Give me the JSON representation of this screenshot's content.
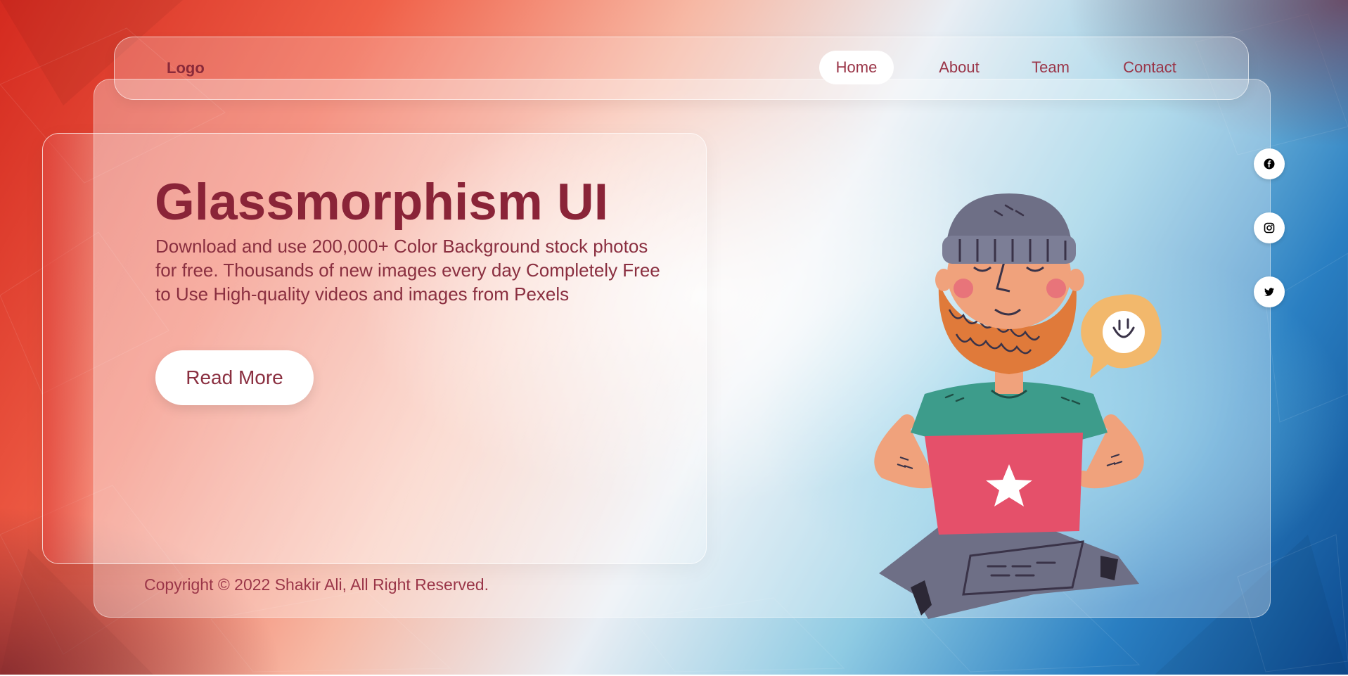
{
  "navbar": {
    "logo": "Logo",
    "items": [
      {
        "label": "Home",
        "active": true
      },
      {
        "label": "About",
        "active": false
      },
      {
        "label": "Team",
        "active": false
      },
      {
        "label": "Contact",
        "active": false
      }
    ]
  },
  "hero": {
    "title": "Glassmorphism UI",
    "description": "Download and use 200,000+ Color Background stock photos for free. Thousands of new images every day Completely Free to Use High-quality videos and images from Pexels",
    "button_label": "Read More"
  },
  "footer": {
    "copyright": "Copyright © 2022 Shakir Ali, All Right Reserved."
  },
  "social": [
    {
      "icon": "facebook-icon"
    },
    {
      "icon": "instagram-icon"
    },
    {
      "icon": "twitter-icon"
    }
  ],
  "colors": {
    "accent_text": "#8a2438",
    "nav_active_bg": "#ffffff",
    "background_start": "#d42a1f",
    "background_end": "#0d4a8f"
  }
}
